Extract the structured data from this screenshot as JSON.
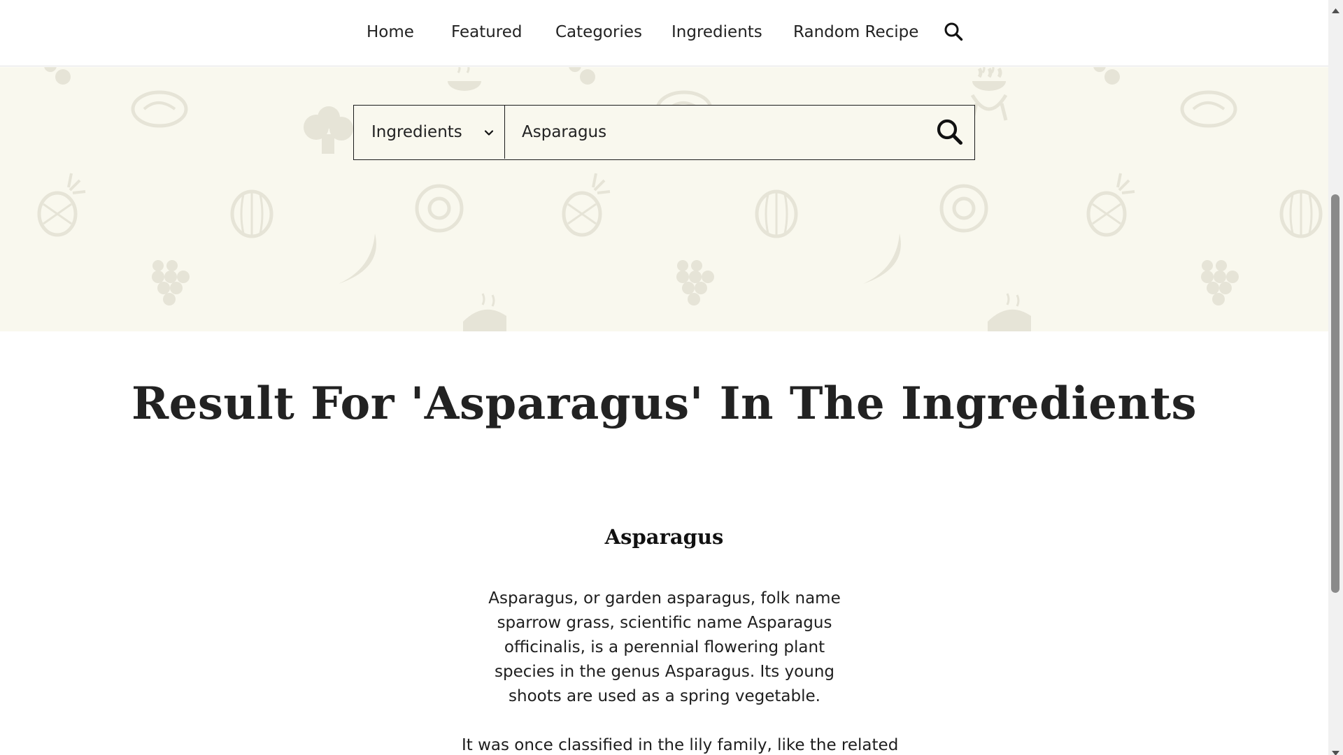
{
  "nav": {
    "items": [
      {
        "label": "Home"
      },
      {
        "label": "Featured"
      },
      {
        "label": "Categories"
      },
      {
        "label": "Ingredients"
      },
      {
        "label": "Random Recipe"
      }
    ],
    "search_icon": "search-icon"
  },
  "search": {
    "category_selected": "Ingredients",
    "query": "Asparagus",
    "submit_icon": "search-icon"
  },
  "result": {
    "title": "Result For 'Asparagus' In The Ingredients",
    "ingredient_name": "Asparagus",
    "description_1": "Asparagus, or garden asparagus, folk name sparrow grass, scientific name Asparagus officinalis, is a perennial flowering plant species in the genus Asparagus. Its young shoots are used as a spring vegetable.",
    "description_2": "It was once classified in the lily family, like the related"
  },
  "colors": {
    "hero_background": "#f9f8ee",
    "pattern_icons": "#e6e4d7",
    "text": "#1e1e1e"
  }
}
